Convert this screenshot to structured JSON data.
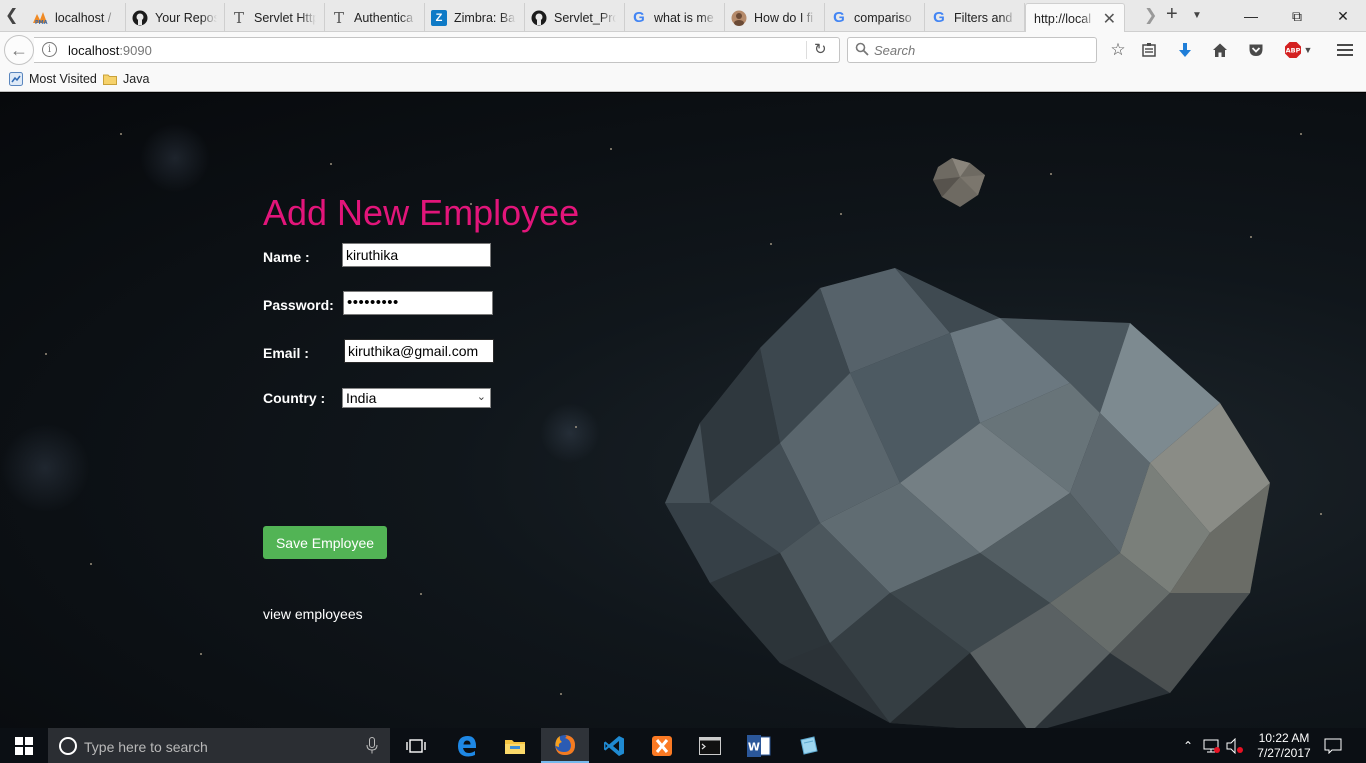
{
  "browser": {
    "tabs": [
      {
        "label": "localhost /",
        "icon": "phpmyadmin-icon"
      },
      {
        "label": "Your Repos",
        "icon": "github-icon"
      },
      {
        "label": "Servlet Http",
        "icon": "serif-t-icon"
      },
      {
        "label": "Authentica",
        "icon": "serif-t-icon"
      },
      {
        "label": "Zimbra: Ba",
        "icon": "zimbra-icon"
      },
      {
        "label": "Servlet_Pro",
        "icon": "github-icon"
      },
      {
        "label": "what is me",
        "icon": "google-icon"
      },
      {
        "label": "How do I fi",
        "icon": "avatar-icon"
      },
      {
        "label": "compariso",
        "icon": "google-icon"
      },
      {
        "label": "Filters and",
        "icon": "google-icon"
      },
      {
        "label": "http://local",
        "icon": "none",
        "active": true
      }
    ],
    "url_host": "localhost",
    "url_port": ":9090",
    "search_placeholder": "Search",
    "bookmarks": [
      {
        "label": "Most Visited",
        "icon": "most-visited-icon"
      },
      {
        "label": "Java",
        "icon": "folder-icon"
      }
    ],
    "abp_label": "ABP"
  },
  "page": {
    "title": "Add New Employee",
    "name_label": "Name :",
    "name_value": "kiruthika",
    "password_label": "Password:",
    "password_value": "•••••••••",
    "email_label": "Email :",
    "email_value": "kiruthika@gmail.com",
    "country_label": "Country :",
    "country_value": "India",
    "save_label": "Save Employee",
    "view_link": "view employees",
    "title_color": "#e2157a",
    "button_color": "#52b455"
  },
  "taskbar": {
    "search_placeholder": "Type here to search",
    "time": "10:22 AM",
    "date": "7/27/2017"
  }
}
